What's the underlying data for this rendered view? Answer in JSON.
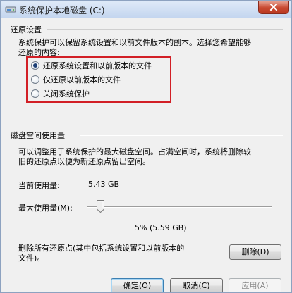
{
  "window": {
    "title": "系统保护本地磁盘 (C:)"
  },
  "restore_settings": {
    "heading": "还原设置",
    "description_line1": "系统保护可以保留系统设置和以前文件版本的副本。选择您希望能够",
    "description_line2": "还原的内容:",
    "options": [
      {
        "label": "还原系统设置和以前版本的文件",
        "checked": true
      },
      {
        "label": "仅还原以前版本的文件",
        "checked": false
      },
      {
        "label": "关闭系统保护",
        "checked": false
      }
    ]
  },
  "disk_usage": {
    "heading": "磁盘空间使用量",
    "description_line1": "可以调整用于系统保护的最大磁盘空间。占满空间时，系统将删除较",
    "description_line2": "旧的还原点以便为新还原点留出空间。",
    "current_label": "当前使用量:",
    "current_value": "5.43 GB",
    "max_label": "最大使用量(M):",
    "max_value": "5% (5.59 GB)",
    "max_percent": 5
  },
  "delete_section": {
    "text_line1": "删除所有还原点(其中包括系统设置和以前版本的",
    "text_line2": "文件)。",
    "delete_button": "删除(D)"
  },
  "footer": {
    "ok": "确定(O)",
    "cancel": "取消(C)",
    "apply": "应用(A)"
  },
  "colors": {
    "highlight_border": "#d21f26"
  }
}
